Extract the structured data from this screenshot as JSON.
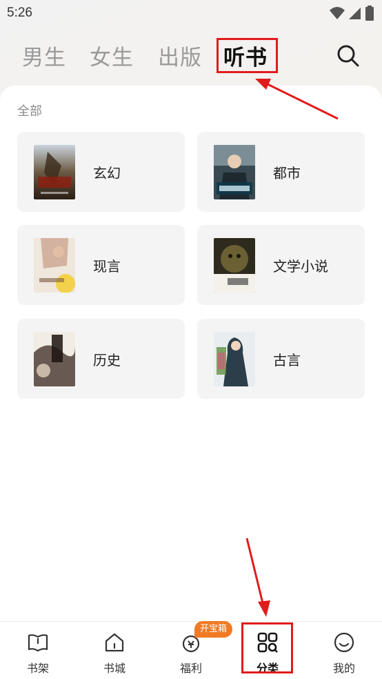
{
  "status_bar": {
    "time": "5:26"
  },
  "top_tabs": [
    {
      "label": "男生"
    },
    {
      "label": "女生"
    },
    {
      "label": "出版"
    },
    {
      "label": "听书"
    }
  ],
  "section_title": "全部",
  "categories": [
    {
      "label": "玄幻"
    },
    {
      "label": "都市"
    },
    {
      "label": "现言"
    },
    {
      "label": "文学小说"
    },
    {
      "label": "历史"
    },
    {
      "label": "古言"
    }
  ],
  "bottom_nav": [
    {
      "label": "书架"
    },
    {
      "label": "书城"
    },
    {
      "label": "福利"
    },
    {
      "label": "分类"
    },
    {
      "label": "我的"
    }
  ],
  "badge": "开宝箱",
  "colors": {
    "accent": "#e01b1b",
    "badge": "#f07a24"
  }
}
